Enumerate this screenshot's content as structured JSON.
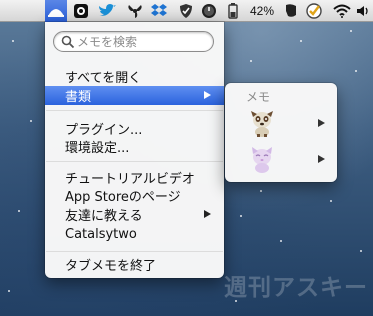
{
  "menubar": {
    "battery_text": "42%"
  },
  "menu": {
    "search_placeholder": "メモを検索",
    "items": [
      {
        "label": "すべてを開く"
      },
      {
        "label": "書類"
      },
      {
        "label": "プラグイン..."
      },
      {
        "label": "環境設定..."
      },
      {
        "label": "チュートリアルビデオ"
      },
      {
        "label": "App Storeのページ"
      },
      {
        "label": "友達に教える"
      },
      {
        "label": "Catalsytwo"
      },
      {
        "label": "タブメモを終了"
      }
    ]
  },
  "submenu": {
    "header": "メモ",
    "items": [
      {
        "icon": "brown-cat-icon"
      },
      {
        "icon": "purple-cat-icon"
      }
    ]
  },
  "watermark": "週刊アスキー",
  "colors": {
    "highlight": "#2b63dd",
    "menu_bg": "#f8f8f8"
  }
}
